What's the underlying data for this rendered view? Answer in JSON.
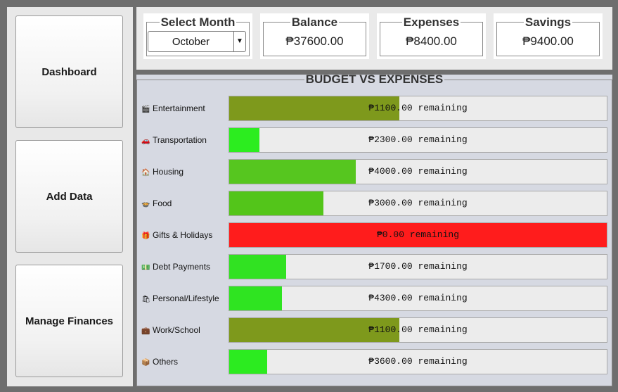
{
  "sidebar": {
    "dashboard_label": "Dashboard",
    "add_data_label": "Add Data",
    "manage_label": "Manage Finances"
  },
  "header": {
    "month": {
      "label": "Select Month",
      "value": "October"
    },
    "balance": {
      "label": "Balance",
      "value": "₱37600.00"
    },
    "expenses": {
      "label": "Expenses",
      "value": "₱8400.00"
    },
    "savings": {
      "label": "Savings",
      "value": "₱9400.00"
    }
  },
  "budget": {
    "title": "BUDGET VS EXPENSES",
    "rows": [
      {
        "label": "Entertainment",
        "icon": "clapper-icon",
        "glyph": "🎬",
        "remaining": "₱1100.00 remaining",
        "fill": 0.45,
        "color": "#7e991c"
      },
      {
        "label": "Transportation",
        "icon": "car-icon",
        "glyph": "🚗",
        "remaining": "₱2300.00 remaining",
        "fill": 0.08,
        "color": "#2ced1f"
      },
      {
        "label": "Housing",
        "icon": "house-icon",
        "glyph": "🏠",
        "remaining": "₱4000.00 remaining",
        "fill": 0.335,
        "color": "#56c61f"
      },
      {
        "label": "Food",
        "icon": "food-icon",
        "glyph": "🍲",
        "remaining": "₱3000.00 remaining",
        "fill": 0.25,
        "color": "#53c51a"
      },
      {
        "label": "Gifts & Holidays",
        "icon": "gift-icon",
        "glyph": "🎁",
        "remaining": "₱0.00 remaining",
        "fill": 1.0,
        "color": "#ff1c1c"
      },
      {
        "label": "Debt Payments",
        "icon": "money-icon",
        "glyph": "💵",
        "remaining": "₱1700.00 remaining",
        "fill": 0.15,
        "color": "#31e222"
      },
      {
        "label": "Personal/Lifestyle",
        "icon": "shopping-icon",
        "glyph": "🛍",
        "remaining": "₱4300.00 remaining",
        "fill": 0.14,
        "color": "#2fe421"
      },
      {
        "label": "Work/School",
        "icon": "briefcase-icon",
        "glyph": "💼",
        "remaining": "₱1100.00 remaining",
        "fill": 0.45,
        "color": "#7e991c"
      },
      {
        "label": "Others",
        "icon": "box-icon",
        "glyph": "📦",
        "remaining": "₱3600.00 remaining",
        "fill": 0.1,
        "color": "#2ceb20"
      }
    ]
  }
}
